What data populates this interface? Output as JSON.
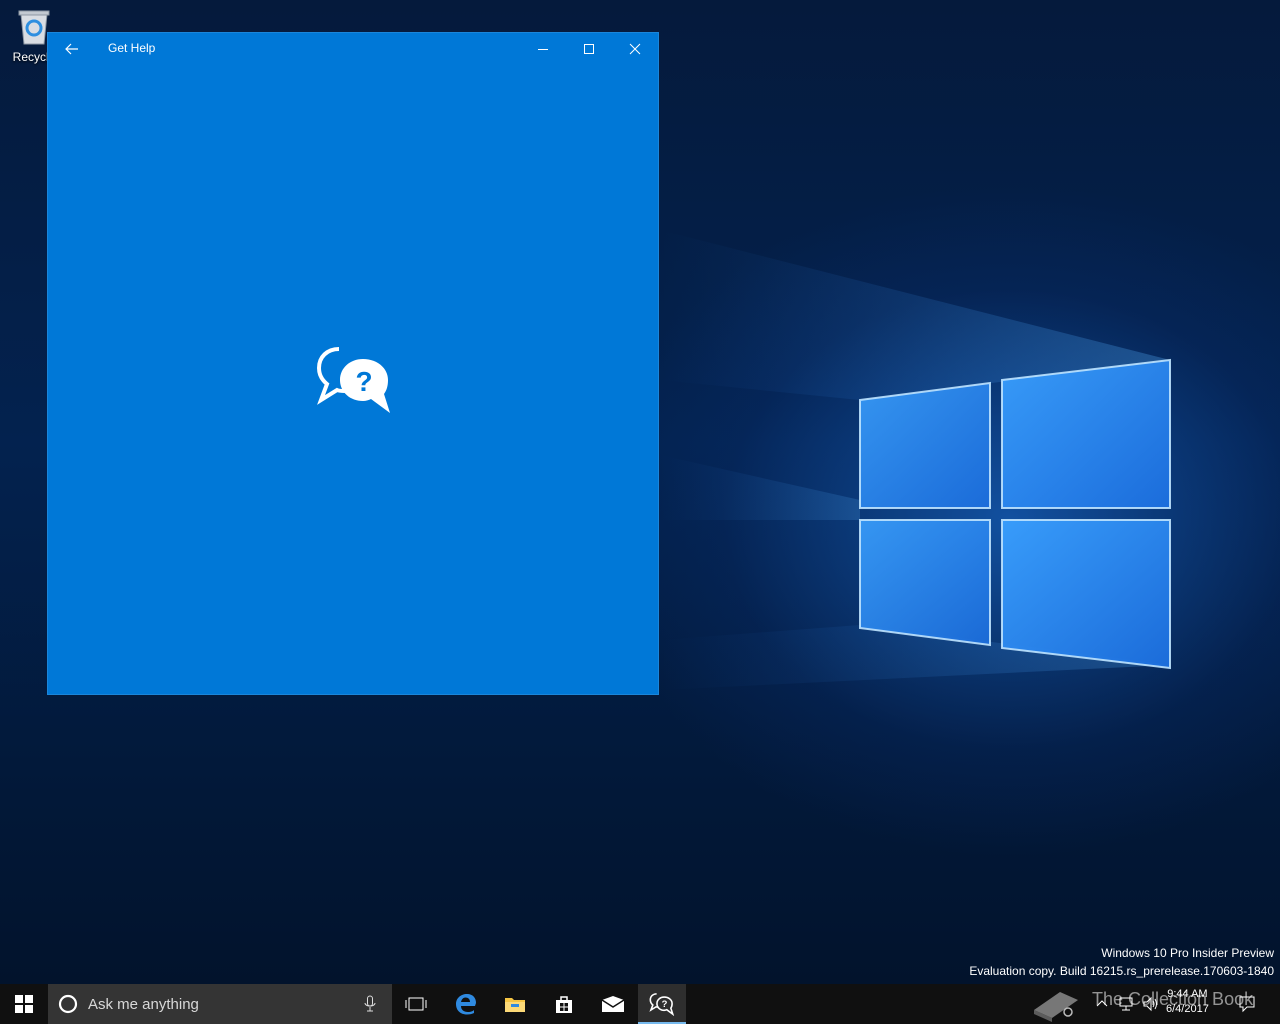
{
  "desktop": {
    "icons": [
      {
        "label": "Recycle",
        "icon": "recycle-bin-icon"
      }
    ],
    "watermark": {
      "line1": "Windows 10 Pro Insider Preview",
      "line2": "Evaluation copy. Build 16215.rs_prerelease.170603-1840"
    }
  },
  "window": {
    "title": "Get Help",
    "back_icon": "back-arrow-icon",
    "splash_icon": "get-help-chat-icon",
    "controls": [
      "minimize-icon",
      "maximize-icon",
      "close-icon"
    ],
    "accent": "#0078d7"
  },
  "taskbar": {
    "search_placeholder": "Ask me anything",
    "apps": [
      "task-view-icon",
      "edge-icon",
      "file-explorer-icon",
      "store-icon",
      "mail-icon",
      "get-help-icon"
    ],
    "active_app": "get-help-icon",
    "overlay_text": "The Collection Book",
    "clock": {
      "time": "9:44 AM",
      "date": "6/4/2017"
    }
  }
}
